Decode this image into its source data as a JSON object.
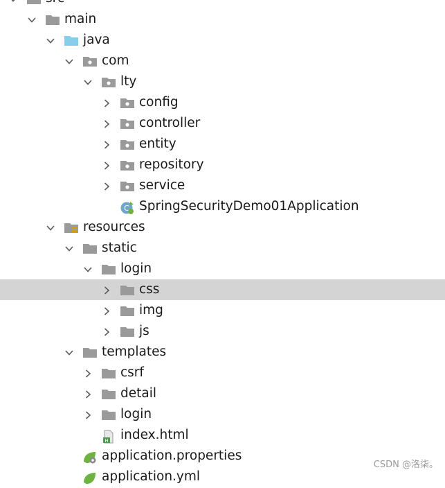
{
  "project_tree": {
    "items": [
      {
        "label": "src",
        "icon": "folder-icon",
        "expanded": true,
        "selected": false
      },
      {
        "label": "main",
        "icon": "folder-icon",
        "expanded": true,
        "selected": false
      },
      {
        "label": "java",
        "icon": "source-folder-icon",
        "expanded": true,
        "selected": false
      },
      {
        "label": "com",
        "icon": "package-icon",
        "expanded": true,
        "selected": false
      },
      {
        "label": "lty",
        "icon": "package-icon",
        "expanded": true,
        "selected": false
      },
      {
        "label": "config",
        "icon": "package-icon",
        "expanded": false,
        "selected": false
      },
      {
        "label": "controller",
        "icon": "package-icon",
        "expanded": false,
        "selected": false
      },
      {
        "label": "entity",
        "icon": "package-icon",
        "expanded": false,
        "selected": false
      },
      {
        "label": "repository",
        "icon": "package-icon",
        "expanded": false,
        "selected": false
      },
      {
        "label": "service",
        "icon": "package-icon",
        "expanded": false,
        "selected": false
      },
      {
        "label": "SpringSecurityDemo01Application",
        "icon": "spring-boot-class-icon",
        "expanded": null,
        "selected": false
      },
      {
        "label": "resources",
        "icon": "resources-folder-icon",
        "expanded": true,
        "selected": false
      },
      {
        "label": "static",
        "icon": "folder-icon",
        "expanded": true,
        "selected": false
      },
      {
        "label": "login",
        "icon": "folder-icon",
        "expanded": true,
        "selected": false
      },
      {
        "label": "css",
        "icon": "folder-icon",
        "expanded": false,
        "selected": true
      },
      {
        "label": "img",
        "icon": "folder-icon",
        "expanded": false,
        "selected": false
      },
      {
        "label": "js",
        "icon": "folder-icon",
        "expanded": false,
        "selected": false
      },
      {
        "label": "templates",
        "icon": "folder-icon",
        "expanded": true,
        "selected": false
      },
      {
        "label": "csrf",
        "icon": "folder-icon",
        "expanded": false,
        "selected": false
      },
      {
        "label": "detail",
        "icon": "folder-icon",
        "expanded": false,
        "selected": false
      },
      {
        "label": "login",
        "icon": "folder-icon",
        "expanded": false,
        "selected": false
      },
      {
        "label": "index.html",
        "icon": "html-file-icon",
        "expanded": null,
        "selected": false
      },
      {
        "label": "application.properties",
        "icon": "spring-properties-icon",
        "expanded": null,
        "selected": false
      },
      {
        "label": "application.yml",
        "icon": "spring-yml-icon",
        "expanded": null,
        "selected": false
      }
    ]
  },
  "watermark": "CSDN @洛柒。",
  "colors": {
    "selection": "#d4d4d4",
    "folder": "#9a9a9a",
    "source_folder": "#87cfe8",
    "chevron": "#5a5a5a",
    "spring_green": "#6db33f"
  }
}
